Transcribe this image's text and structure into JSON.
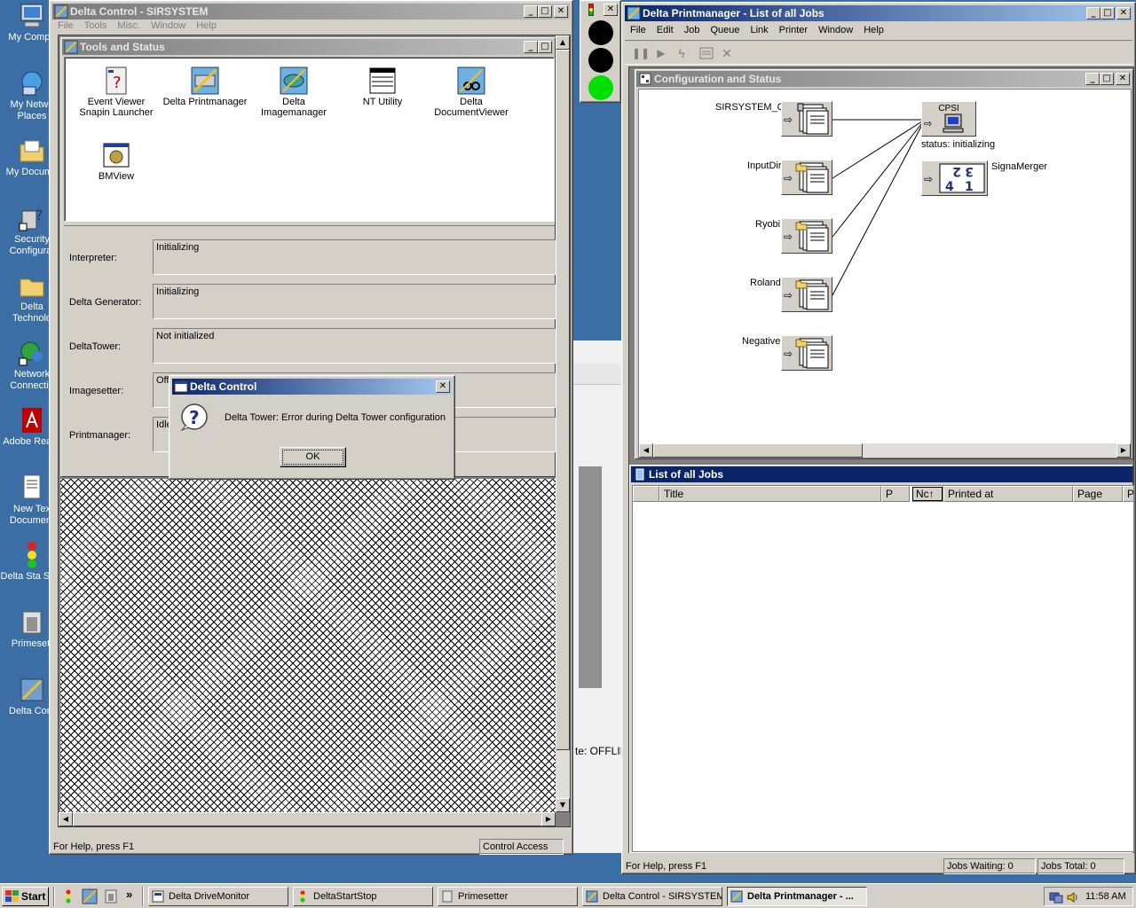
{
  "desktop": {
    "icons": [
      {
        "label": "My Compu"
      },
      {
        "label": "My Netwo Places"
      },
      {
        "label": "My Docume"
      },
      {
        "label": "Security Configurat"
      },
      {
        "label": "Delta Technolo"
      },
      {
        "label": "Network Connectio"
      },
      {
        "label": "Adobe Rea X"
      },
      {
        "label": "New Tex Document"
      },
      {
        "label": "Delta Sta Stop"
      },
      {
        "label": "Primesett"
      },
      {
        "label": "Delta Cont"
      }
    ]
  },
  "delta_control": {
    "title": "Delta Control - SIRSYSTEM",
    "menu": [
      "File",
      "Tools",
      "Misc.",
      "Window",
      "Help"
    ],
    "tools_window": {
      "title": "Tools and Status",
      "tools": [
        {
          "label": "Event Viewer Snapin Launcher",
          "icon": "event-viewer-icon"
        },
        {
          "label": "Delta Printmanager",
          "icon": "printmanager-icon"
        },
        {
          "label": "Delta Imagemanager",
          "icon": "imagemanager-icon"
        },
        {
          "label": "NT Utility",
          "icon": "nt-utility-icon"
        },
        {
          "label": "Delta DocumentViewer",
          "icon": "documentviewer-icon"
        },
        {
          "label": "BMView",
          "icon": "bmview-icon"
        }
      ],
      "status_rows": [
        {
          "label": "Interpreter:",
          "value": "Initializing"
        },
        {
          "label": "Delta Generator:",
          "value": "Initializing"
        },
        {
          "label": "DeltaTower:",
          "value": "Not initialized"
        },
        {
          "label": "Imagesetter:",
          "value": "Off"
        },
        {
          "label": "Printmanager:",
          "value": "Idle"
        }
      ]
    },
    "status_left": "For Help, press F1",
    "status_right": "Control Access"
  },
  "dialog": {
    "title": "Delta Control",
    "message": "Delta Tower: Error during Delta Tower configuration",
    "ok": "OK"
  },
  "background_window": {
    "partial_text": "te:  OFFLII"
  },
  "printmanager": {
    "title": "Delta Printmanager - List of all Jobs",
    "menu": [
      "File",
      "Edit",
      "Job",
      "Queue",
      "Link",
      "Printer",
      "Window",
      "Help"
    ],
    "config_window": {
      "title": "Configuration and Status",
      "nodes": [
        {
          "label": "SIRSYSTEM_Q"
        },
        {
          "label": "InputDir"
        },
        {
          "label": "Ryobi"
        },
        {
          "label": "Roland"
        },
        {
          "label": "Negative"
        }
      ],
      "cpsi": {
        "label": "CPSI",
        "status": "status: initializing"
      },
      "merger": {
        "label": "SignaMerger",
        "digits": "2 3 4 1"
      }
    },
    "jobs_window": {
      "title": "List of all Jobs",
      "columns": [
        "",
        "Title",
        "P",
        "Nc↑",
        "Printed at",
        "Page",
        "P"
      ]
    },
    "status_left": "For Help, press F1",
    "jobs_waiting": "Jobs Waiting: 0",
    "jobs_total": "Jobs Total: 0"
  },
  "taskbar": {
    "start": "Start",
    "tasks": [
      {
        "label": "Delta DriveMonitor"
      },
      {
        "label": "DeltaStartStop"
      },
      {
        "label": "Primesetter"
      },
      {
        "label": "Delta Control - SIRSYSTEM"
      },
      {
        "label": "Delta Printmanager - ..."
      }
    ],
    "clock": "11:58 AM",
    "quicklaunch_more": "»"
  },
  "colors": {
    "desktop": "#3a6ea5",
    "title_active": "#0a246a",
    "traffic_green": "#00e000"
  }
}
